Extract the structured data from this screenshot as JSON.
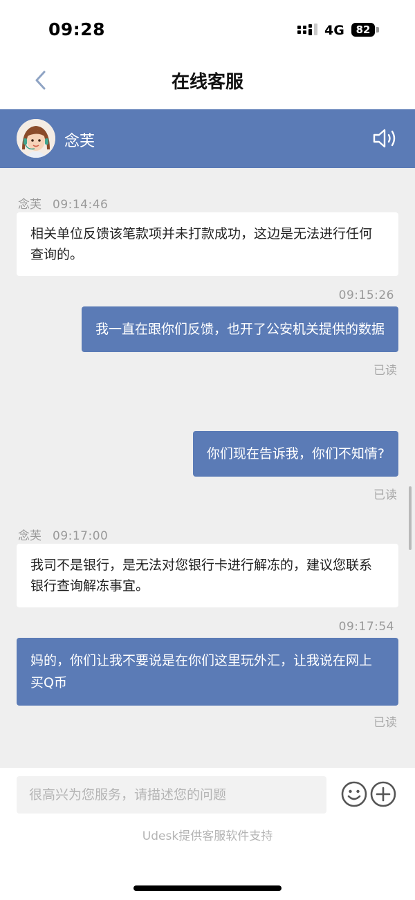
{
  "status": {
    "time": "09:28",
    "network": "4G",
    "battery": "82"
  },
  "nav": {
    "title": "在线客服"
  },
  "agent": {
    "name": "念芙"
  },
  "messages": [
    {
      "sender": "念芙",
      "time": "09:14:46",
      "text": "相关单位反馈该笔款项并未打款成功，这边是无法进行任何查询的。"
    },
    {
      "time": "09:15:26",
      "text": "我一直在跟你们反馈，也开了公安机关提供的数据",
      "status": "已读"
    },
    {
      "text": "你们现在告诉我，你们不知情?",
      "status": "已读"
    },
    {
      "sender": "念芙",
      "time": "09:17:00",
      "text": "我司不是银行，是无法对您银行卡进行解冻的，建议您联系银行查询解冻事宜。"
    },
    {
      "time": "09:17:54",
      "text": "妈的，你们让我不要说是在你们这里玩外汇，让我说在网上买Q币",
      "status": "已读"
    }
  ],
  "input": {
    "placeholder": "很高兴为您服务，请描述您的问题"
  },
  "footer": {
    "powered_by": "Udesk提供客服软件支持"
  },
  "colors": {
    "accent": "#5b7bb6",
    "background": "#efefef"
  },
  "icons": [
    "back-chevron-icon",
    "speaker-icon",
    "emoji-icon",
    "plus-circle-icon"
  ]
}
